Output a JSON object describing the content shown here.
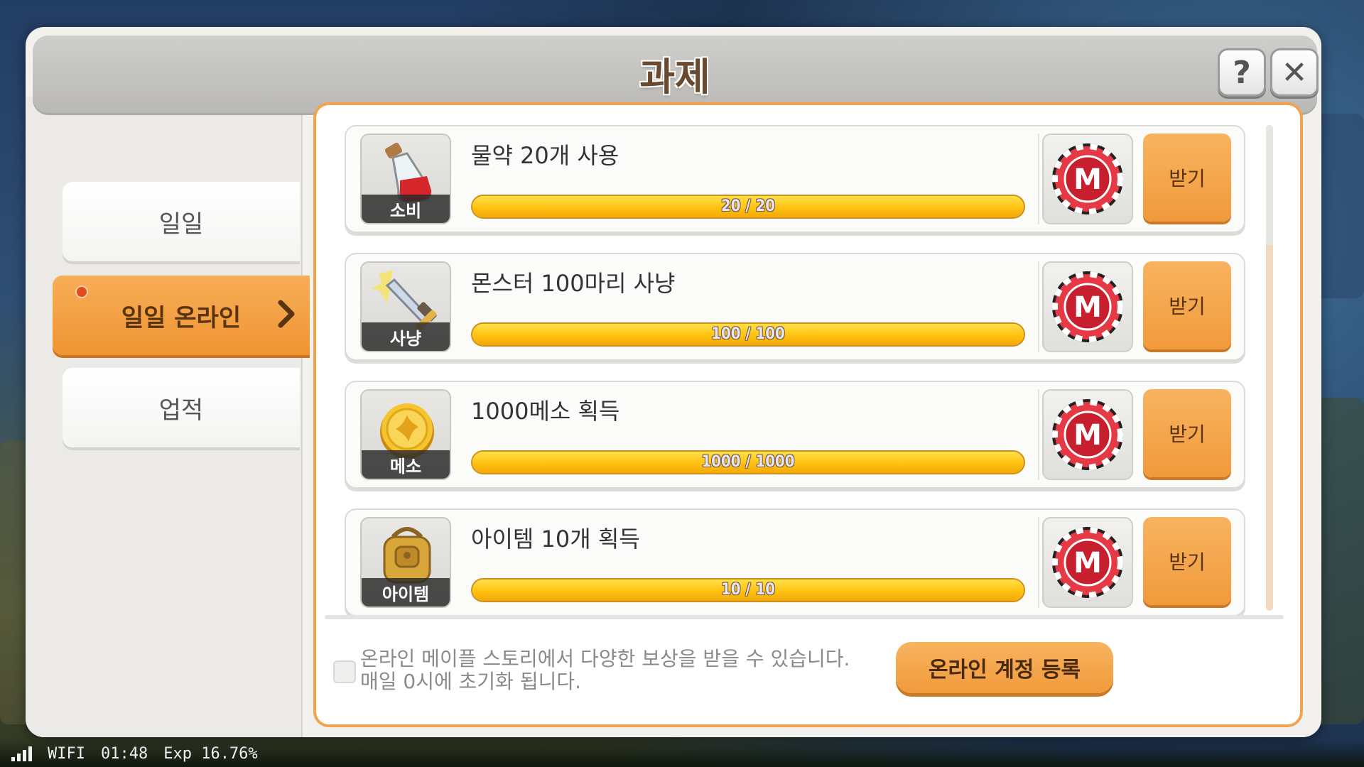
{
  "status_bar": {
    "network": "WIFI",
    "time": "01:48",
    "exp": "Exp 16.76%"
  },
  "dialog": {
    "title": "과제",
    "help_label": "?",
    "close_label": "✕"
  },
  "sidebar": {
    "items": [
      {
        "label": "일일",
        "active": false
      },
      {
        "label": "일일 온라인",
        "active": true,
        "has_notification": true
      },
      {
        "label": "업적",
        "active": false
      }
    ]
  },
  "quests": [
    {
      "title": "물약 20개 사용",
      "category": "소비",
      "icon": "potion-icon",
      "current": 20,
      "goal": 20,
      "progress_text": "20 / 20",
      "reward_icon": "meso-chip-icon",
      "claim_label": "받기"
    },
    {
      "title": "몬스터 100마리 사냥",
      "category": "사냥",
      "icon": "sword-icon",
      "current": 100,
      "goal": 100,
      "progress_text": "100 / 100",
      "reward_icon": "meso-chip-icon",
      "claim_label": "받기"
    },
    {
      "title": "1000메소 획득",
      "category": "메소",
      "icon": "coin-icon",
      "current": 1000,
      "goal": 1000,
      "progress_text": "1000 / 1000",
      "reward_icon": "meso-chip-icon",
      "claim_label": "받기"
    },
    {
      "title": "아이템 10개 획득",
      "category": "아이템",
      "icon": "backpack-icon",
      "current": 10,
      "goal": 10,
      "progress_text": "10 / 10",
      "reward_icon": "meso-chip-icon",
      "claim_label": "받기"
    }
  ],
  "footer": {
    "line1": "온라인 메이플 스토리에서 다양한 보상을 받을 수 있습니다.",
    "line2": "매일 0시에 초기화 됩니다.",
    "register_label": "온라인 계정 등록"
  },
  "colors": {
    "accent": "#f19a3c",
    "panel_border": "#f3a24e",
    "title_text": "#6a4a2e"
  }
}
